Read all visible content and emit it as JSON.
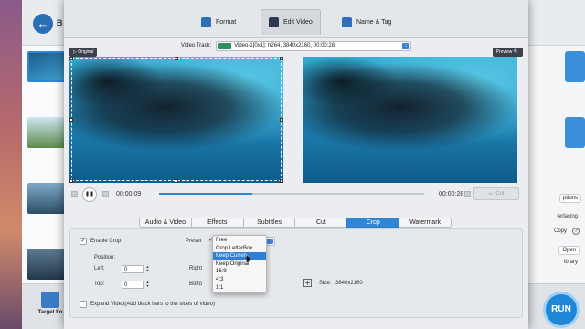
{
  "background": {
    "title_fragment": "B",
    "target_format_label": "Target Fo",
    "run_label": "RUN",
    "right_panel": {
      "options_label": "ptions",
      "deinterlacing_label": "terlacing",
      "copy_label": "Copy",
      "help_label": "?",
      "open_label": "Open",
      "library_label": "ibrary"
    }
  },
  "dialog": {
    "tabs": [
      {
        "label": "Format",
        "icon": "format-icon"
      },
      {
        "label": "Edit Video",
        "icon": "edit-video-icon",
        "active": true
      },
      {
        "label": "Name & Tag",
        "icon": "name-tag-icon"
      }
    ],
    "video_track": {
      "label": "Video Track:",
      "value": "Video-1[0x1]: h264, 3840x2160, 00:00:28"
    },
    "original_label": "Original",
    "preview_label": "Preview",
    "player": {
      "current_time": "00:00:09",
      "total_time": "00:00:28",
      "progress": 0.35,
      "cut_label": "Cut"
    },
    "sub_tabs": [
      "Audio & Video",
      "Effects",
      "Subtitles",
      "Cut",
      "Crop",
      "Watermark"
    ],
    "active_sub_tab": "Crop",
    "crop": {
      "enable_label": "Enable Crop",
      "enable_checked": true,
      "preset_label": "Preset",
      "position_label": "Position:",
      "left_label": "Left:",
      "left_value": "0",
      "top_label": "Top:",
      "top_value": "0",
      "right_label": "Right",
      "bottom_label": "Botto",
      "size_label": "Size:",
      "size_value": "3840x2160",
      "expand_label": "Expand Video(Add black bars to the sides of video)",
      "expand_checked": false
    },
    "preset_dropdown": {
      "options": [
        "Free",
        "Crop LetterBox",
        "Keep Curren",
        "Keep Original",
        "16:9",
        "4:3",
        "1:1"
      ],
      "checked": "Free",
      "highlighted": "Keep Curren"
    }
  },
  "colors": {
    "accent": "#2f86d6",
    "dialog_bg": "#ebedf0"
  }
}
